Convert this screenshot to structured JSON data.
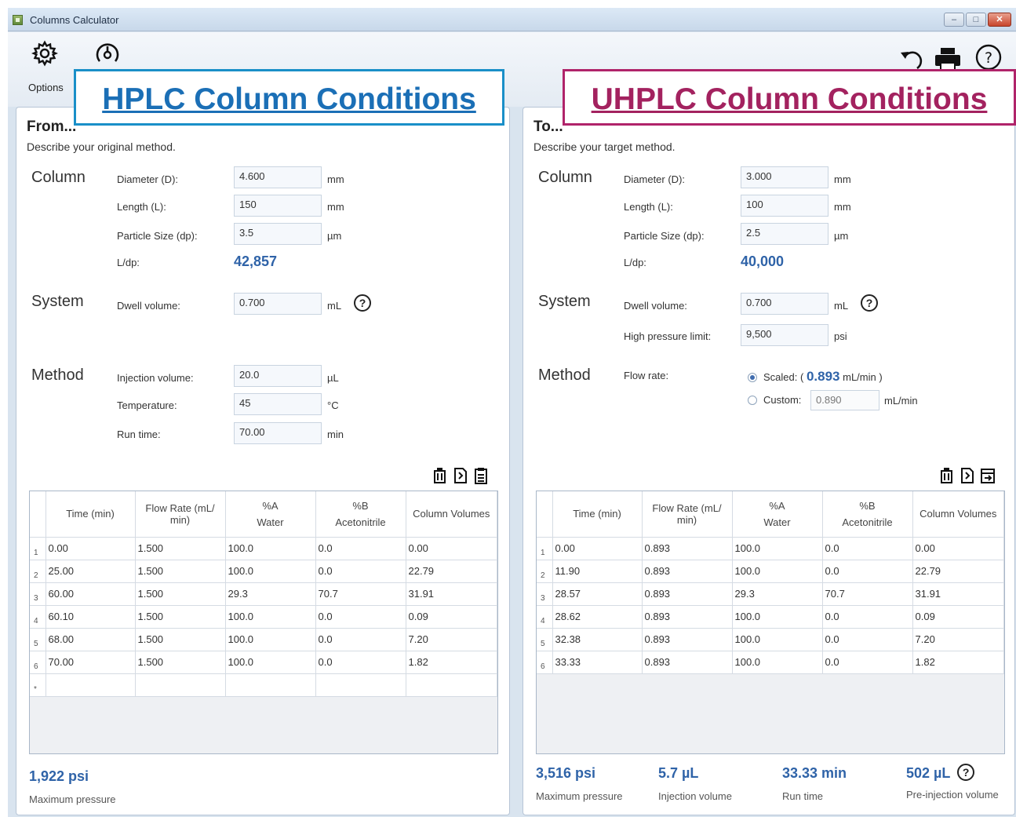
{
  "window": {
    "title": "Columns Calculator"
  },
  "toolbar": {
    "options_label": "Options"
  },
  "callouts": {
    "hplc": "HPLC Column Conditions",
    "uhplc": "UHPLC Column Conditions"
  },
  "from": {
    "title": "From...",
    "description": "Describe your original method.",
    "column": {
      "heading": "Column",
      "diameter": {
        "label": "Diameter (D):",
        "value": "4.600",
        "unit": "mm"
      },
      "length": {
        "label": "Length (L):",
        "value": "150",
        "unit": "mm"
      },
      "particle": {
        "label": "Particle Size (dp):",
        "value": "3.5",
        "unit": "µm"
      },
      "ldp": {
        "label": "L/dp:",
        "value": "42,857"
      }
    },
    "system": {
      "heading": "System",
      "dwell": {
        "label": "Dwell volume:",
        "value": "0.700",
        "unit": "mL"
      }
    },
    "method": {
      "heading": "Method",
      "injection": {
        "label": "Injection volume:",
        "value": "20.0",
        "unit": "µL"
      },
      "temperature": {
        "label": "Temperature:",
        "value": "45",
        "unit": "°C"
      },
      "runtime": {
        "label": "Run time:",
        "value": "70.00",
        "unit": "min"
      }
    },
    "table": {
      "headers": [
        "Time (min)",
        "Flow Rate (mL/ min)",
        "%A",
        "%B",
        "Column Volumes"
      ],
      "subheaders": [
        "",
        "",
        "Water",
        "Acetonitrile",
        ""
      ],
      "rows": [
        [
          "1",
          "0.00",
          "1.500",
          "100.0",
          "0.0",
          "0.00"
        ],
        [
          "2",
          "25.00",
          "1.500",
          "100.0",
          "0.0",
          "22.79"
        ],
        [
          "3",
          "60.00",
          "1.500",
          "29.3",
          "70.7",
          "31.91"
        ],
        [
          "4",
          "60.10",
          "1.500",
          "100.0",
          "0.0",
          "0.09"
        ],
        [
          "5",
          "68.00",
          "1.500",
          "100.0",
          "0.0",
          "7.20"
        ],
        [
          "6",
          "70.00",
          "1.500",
          "100.0",
          "0.0",
          "1.82"
        ]
      ],
      "new_row_marker": "*"
    },
    "stats": {
      "max_pressure": {
        "value": "1,922 psi",
        "label": "Maximum pressure"
      }
    }
  },
  "to": {
    "title": "To...",
    "description": "Describe your target method.",
    "column": {
      "heading": "Column",
      "diameter": {
        "label": "Diameter (D):",
        "value": "3.000",
        "unit": "mm"
      },
      "length": {
        "label": "Length (L):",
        "value": "100",
        "unit": "mm"
      },
      "particle": {
        "label": "Particle Size (dp):",
        "value": "2.5",
        "unit": "µm"
      },
      "ldp": {
        "label": "L/dp:",
        "value": "40,000"
      }
    },
    "system": {
      "heading": "System",
      "dwell": {
        "label": "Dwell volume:",
        "value": "0.700",
        "unit": "mL"
      },
      "pressure_limit": {
        "label": "High pressure limit:",
        "value": "9,500",
        "unit": "psi"
      }
    },
    "method": {
      "heading": "Method",
      "flow_label": "Flow rate:",
      "scaled_prefix": "Scaled: (",
      "scaled_value": "0.893",
      "scaled_suffix": "mL/min )",
      "custom_label": "Custom:",
      "custom_value": "0.890",
      "custom_unit": "mL/min",
      "selected": "scaled"
    },
    "table": {
      "headers": [
        "Time (min)",
        "Flow Rate (mL/ min)",
        "%A",
        "%B",
        "Column Volumes"
      ],
      "subheaders": [
        "",
        "",
        "Water",
        "Acetonitrile",
        ""
      ],
      "rows": [
        [
          "1",
          "0.00",
          "0.893",
          "100.0",
          "0.0",
          "0.00"
        ],
        [
          "2",
          "11.90",
          "0.893",
          "100.0",
          "0.0",
          "22.79"
        ],
        [
          "3",
          "28.57",
          "0.893",
          "29.3",
          "70.7",
          "31.91"
        ],
        [
          "4",
          "28.62",
          "0.893",
          "100.0",
          "0.0",
          "0.09"
        ],
        [
          "5",
          "32.38",
          "0.893",
          "100.0",
          "0.0",
          "7.20"
        ],
        [
          "6",
          "33.33",
          "0.893",
          "100.0",
          "0.0",
          "1.82"
        ]
      ]
    },
    "stats": {
      "max_pressure": {
        "value": "3,516 psi",
        "label": "Maximum pressure"
      },
      "injection": {
        "value": "5.7  µL",
        "label": "Injection volume"
      },
      "runtime": {
        "value": "33.33  min",
        "label": "Run time"
      },
      "preinjection": {
        "value": "502  µL",
        "label": "Pre-injection volume"
      }
    }
  },
  "icons": {
    "toolbar": [
      "gear-icon",
      "gauge-icon",
      "undo-icon",
      "print-icon",
      "help-icon"
    ],
    "grid_left": [
      "paste-icon",
      "copy-icon",
      "clipboard-icon"
    ],
    "grid_right": [
      "paste-icon",
      "copy-icon",
      "export-icon"
    ]
  },
  "colors": {
    "value_blue": "#2f63a8",
    "hplc_blue": "#1b6fb6",
    "uhplc_magenta": "#a3225f"
  }
}
